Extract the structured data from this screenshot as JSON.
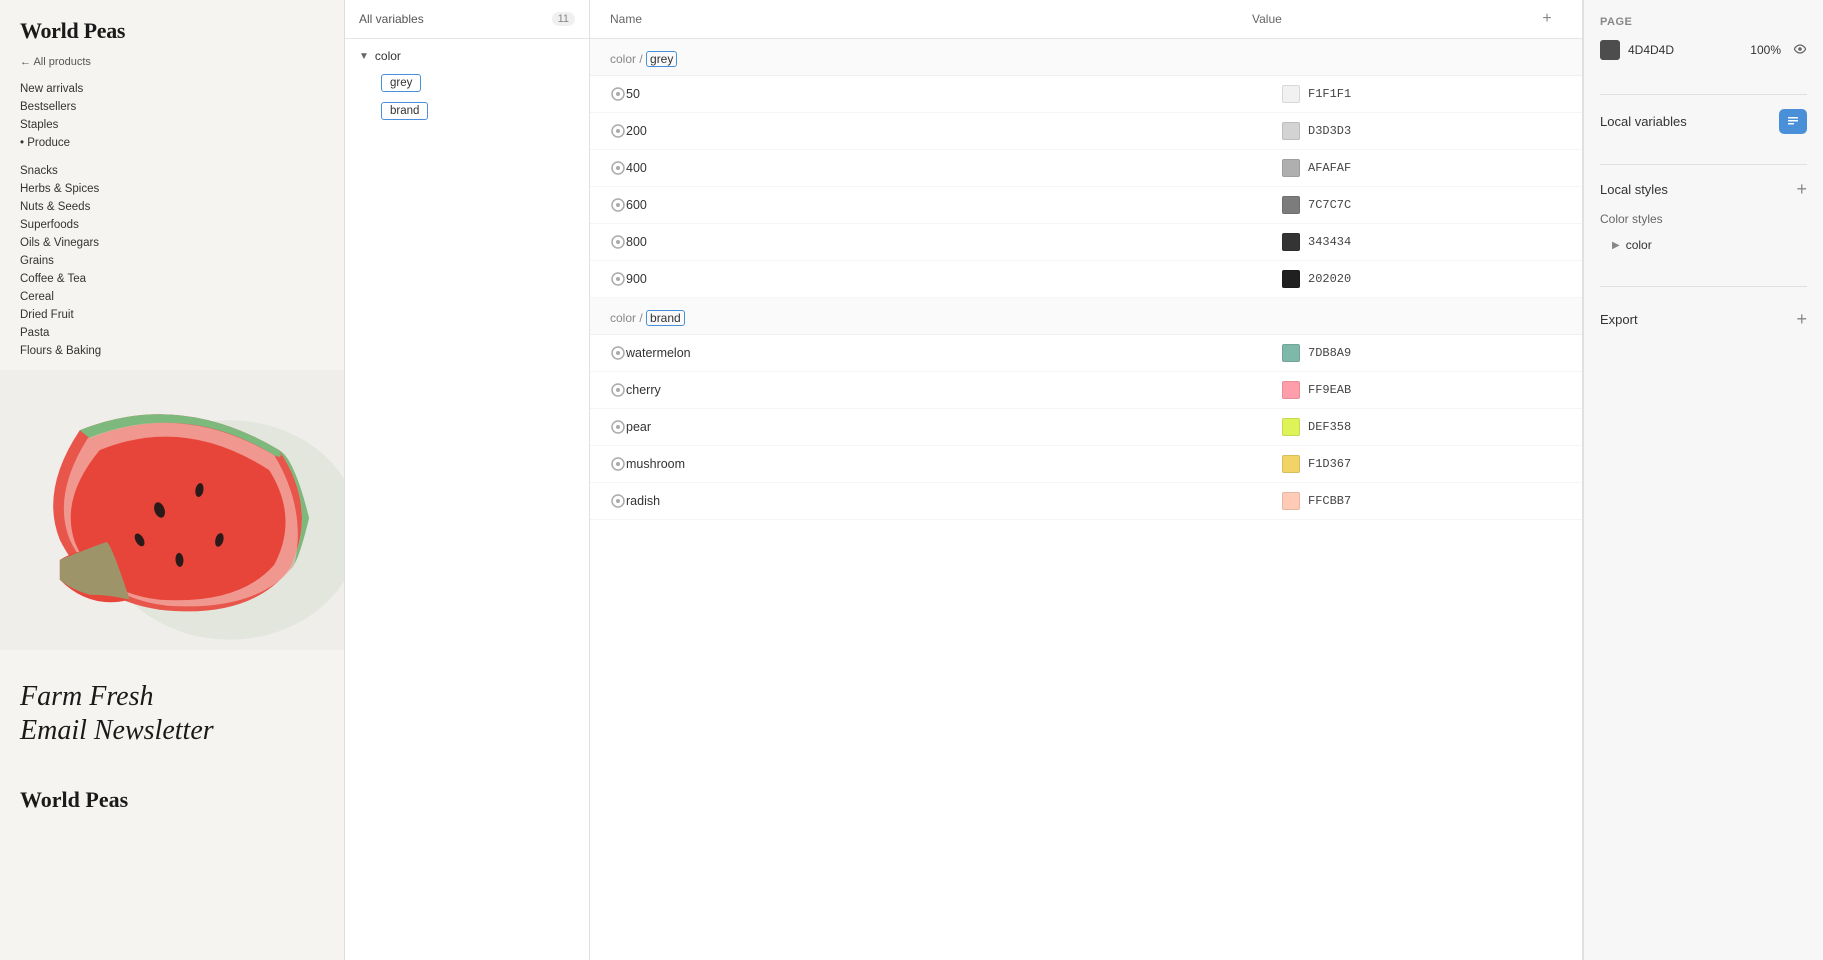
{
  "site": {
    "title": "World Peas",
    "footer_title": "World Peas",
    "back_link": "← All products",
    "nav_items": [
      {
        "label": "New arrivals",
        "type": "normal"
      },
      {
        "label": "Bestsellers",
        "type": "normal"
      },
      {
        "label": "Staples",
        "type": "normal"
      },
      {
        "label": "Produce",
        "type": "bullet"
      }
    ],
    "sub_nav": [
      "Snacks",
      "Herbs & Spices",
      "Nuts & Seeds",
      "Superfoods",
      "Oils & Vinegars",
      "Grains",
      "Coffee & Tea",
      "Cereal",
      "Dried Fruit",
      "Pasta",
      "Flours & Baking"
    ],
    "newsletter_title": "Farm Fresh",
    "newsletter_subtitle": "Email Newsletter"
  },
  "variables_panel": {
    "header": "All variables",
    "count": "11",
    "groups": [
      {
        "name": "color",
        "items": [
          {
            "label": "grey"
          },
          {
            "label": "brand"
          }
        ]
      }
    ]
  },
  "table": {
    "col_name": "Name",
    "col_value": "Value",
    "add_icon": "+",
    "groups": [
      {
        "prefix": "color / ",
        "name": "grey",
        "rows": [
          {
            "name": "50",
            "value": "F1F1F1",
            "color": "#F1F1F1"
          },
          {
            "name": "200",
            "value": "D3D3D3",
            "color": "#D3D3D3"
          },
          {
            "name": "400",
            "value": "AFAFAF",
            "color": "#AFAFAF"
          },
          {
            "name": "600",
            "value": "7C7C7C",
            "color": "#7C7C7C"
          },
          {
            "name": "800",
            "value": "343434",
            "color": "#343434"
          },
          {
            "name": "900",
            "value": "202020",
            "color": "#202020"
          }
        ]
      },
      {
        "prefix": "color / ",
        "name": "brand",
        "rows": [
          {
            "name": "watermelon",
            "value": "7DB8A9",
            "color": "#7DB8A9"
          },
          {
            "name": "cherry",
            "value": "FF9EAB",
            "color": "#FF9EAB"
          },
          {
            "name": "pear",
            "value": "DEF358",
            "color": "#DEF358"
          },
          {
            "name": "mushroom",
            "value": "F1D367",
            "color": "#F1D367"
          },
          {
            "name": "radish",
            "value": "FFCBB7",
            "color": "#FFCBB7"
          }
        ]
      }
    ]
  },
  "right_panel": {
    "page_label": "Page",
    "page_color": "4D4D4D",
    "page_opacity": "100%",
    "local_variables_label": "Local variables",
    "local_styles_label": "Local styles",
    "color_styles_label": "Color styles",
    "color_group_name": "color",
    "export_label": "Export",
    "add_icon": "+"
  }
}
